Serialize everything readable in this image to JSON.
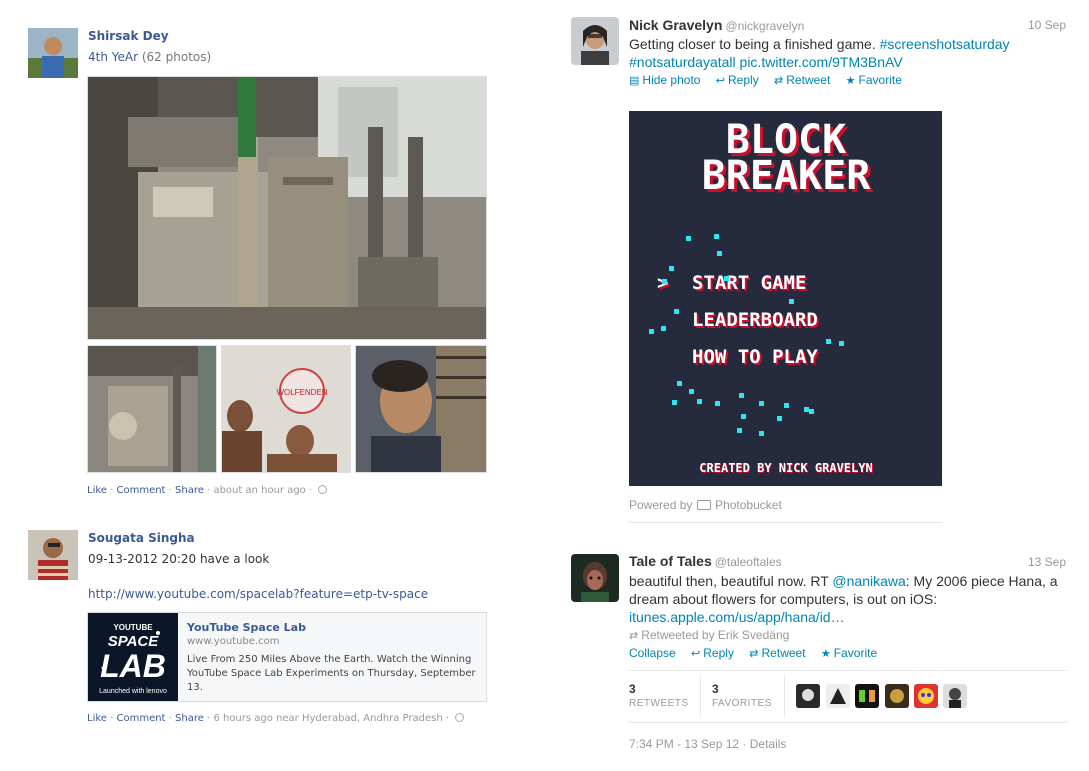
{
  "facebook": {
    "post1": {
      "author": "Shirsak Dey",
      "album": "4th YeAr",
      "photo_count": "(62 photos)",
      "actions": {
        "like": "Like",
        "comment": "Comment",
        "share": "Share",
        "time": "about an hour ago"
      }
    },
    "post2": {
      "author": "Sougata Singha",
      "text": "09-13-2012 20:20 have a look",
      "url": "http://www.youtube.com/spacelab?feature=etp-tv-space",
      "preview": {
        "thumb_line1": "YOUTUBE",
        "thumb_line2": "SPACE",
        "thumb_line3": "LAB",
        "thumb_line4": "Launched with lenovo",
        "title": "YouTube Space Lab",
        "domain": "www.youtube.com",
        "description": "Live From 250 Miles Above the Earth. Watch the Winning YouTube Space Lab Experiments on Thursday, September 13."
      },
      "actions": {
        "like": "Like",
        "comment": "Comment",
        "share": "Share",
        "time": "6 hours ago near Hyderabad, Andhra Pradesh"
      }
    },
    "photo_sign": "WOLFENDEN"
  },
  "twitter": {
    "tweet1": {
      "name": "Nick Gravelyn",
      "handle": "@nickgravelyn",
      "date": "10 Sep",
      "text_plain": "Getting closer to being a finished game.",
      "hashtag1": "#screenshotsaturday",
      "hashtag2": "#notsaturdayatall",
      "pic_link": "pic.twitter.com/9TM3BnAV",
      "actions": {
        "hide_photo": "Hide photo",
        "reply": "Reply",
        "retweet": "Retweet",
        "favorite": "Favorite"
      },
      "game": {
        "title1": "BLOCK",
        "title2": "BREAKER",
        "cursor": ">",
        "menu1": "START GAME",
        "menu2": "LEADERBOARD",
        "menu3": "HOW TO PLAY",
        "credit": "CREATED BY NICK GRAVELYN"
      },
      "powered_by": "Powered by",
      "photobucket": "Photobucket"
    },
    "tweet2": {
      "name": "Tale of Tales",
      "handle": "@taleoftales",
      "date": "13 Sep",
      "text_a": "beautiful then, beautiful now. RT",
      "mention": "@nanikawa",
      "text_b": ": My 2006 piece Hana, a dream about flowers for computers, is out on iOS:",
      "link": "itunes.apple.com/us/app/hana/id…",
      "retweeted_by": "Retweeted by Erik Svedäng",
      "actions": {
        "collapse": "Collapse",
        "reply": "Reply",
        "retweet": "Retweet",
        "favorite": "Favorite"
      },
      "retweets_count": "3",
      "retweets_label": "RETWEETS",
      "favorites_count": "3",
      "favorites_label": "FAVORITES",
      "timestamp": "7:34 PM - 13 Sep 12",
      "details": "Details"
    }
  },
  "colors": {
    "fb_link": "#3b5998",
    "tw_link": "#0084b4",
    "game_bg": "#262a3d",
    "game_particle": "#2ee6ef",
    "game_title_red": "#c8102e"
  }
}
